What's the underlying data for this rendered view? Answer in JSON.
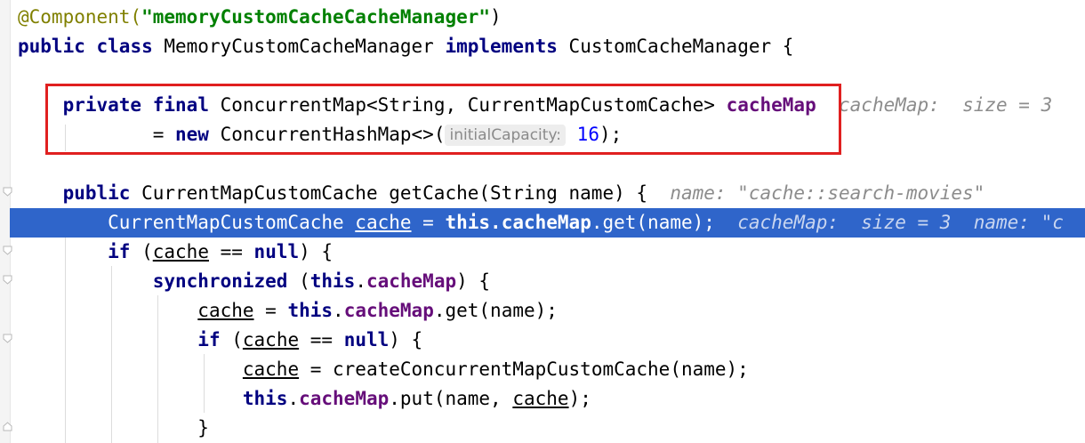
{
  "editor": {
    "lines": [
      {
        "id": "l1",
        "parts": [
          {
            "t": "@Component(",
            "c": "ann"
          },
          {
            "t": "\"memoryCustomCacheCacheManager\"",
            "c": "str"
          },
          {
            "t": ")",
            "c": ""
          }
        ]
      },
      {
        "id": "l2",
        "parts": [
          {
            "t": "public",
            "c": "kw"
          },
          {
            "t": " ",
            "c": ""
          },
          {
            "t": "class",
            "c": "kw"
          },
          {
            "t": " MemoryCustomCacheManager ",
            "c": ""
          },
          {
            "t": "implements",
            "c": "kw"
          },
          {
            "t": " CustomCacheManager {",
            "c": ""
          }
        ]
      },
      {
        "id": "l3",
        "parts": []
      },
      {
        "id": "l4",
        "parts": [
          {
            "t": "    ",
            "c": ""
          },
          {
            "t": "private",
            "c": "kw"
          },
          {
            "t": " ",
            "c": ""
          },
          {
            "t": "final",
            "c": "kw"
          },
          {
            "t": " ConcurrentMap<String, CurrentMapCustomCache> ",
            "c": ""
          },
          {
            "t": "cacheMap",
            "c": "fld"
          },
          {
            "t": "  ",
            "c": ""
          },
          {
            "t": "cacheMap:  size = 3",
            "c": "inlay"
          }
        ]
      },
      {
        "id": "l5",
        "parts": [
          {
            "t": "            = ",
            "c": ""
          },
          {
            "t": "new",
            "c": "kw"
          },
          {
            "t": " ConcurrentHashMap<>(",
            "c": ""
          },
          {
            "t": "initialCapacity:",
            "c": "param-hint"
          },
          {
            "t": " ",
            "c": ""
          },
          {
            "t": "16",
            "c": "num"
          },
          {
            "t": ");",
            "c": ""
          }
        ]
      },
      {
        "id": "l6",
        "parts": []
      },
      {
        "id": "l7",
        "parts": [
          {
            "t": "    ",
            "c": ""
          },
          {
            "t": "public",
            "c": "kw"
          },
          {
            "t": " CurrentMapCustomCache getCache(String name) {  ",
            "c": ""
          },
          {
            "t": "name: \"cache::search-movies\"",
            "c": "inlay"
          }
        ]
      },
      {
        "id": "l8",
        "hl": true,
        "parts": [
          {
            "t": "        CurrentMapCustomCache ",
            "c": ""
          },
          {
            "t": "cache",
            "c": "ul"
          },
          {
            "t": " = ",
            "c": ""
          },
          {
            "t": "this",
            "c": "kw"
          },
          {
            "t": ".",
            "c": "kw"
          },
          {
            "t": "cacheMap",
            "c": "fld"
          },
          {
            "t": ".get(name);  ",
            "c": ""
          },
          {
            "t": "cacheMap:  size = 3  name: \"c",
            "c": "inlay"
          }
        ]
      },
      {
        "id": "l9",
        "parts": [
          {
            "t": "        ",
            "c": ""
          },
          {
            "t": "if",
            "c": "kw"
          },
          {
            "t": " (",
            "c": ""
          },
          {
            "t": "cache",
            "c": "ul"
          },
          {
            "t": " == ",
            "c": ""
          },
          {
            "t": "null",
            "c": "kw"
          },
          {
            "t": ") {",
            "c": ""
          }
        ]
      },
      {
        "id": "l10",
        "parts": [
          {
            "t": "            ",
            "c": ""
          },
          {
            "t": "synchronized",
            "c": "kw"
          },
          {
            "t": " (",
            "c": ""
          },
          {
            "t": "this",
            "c": "kw"
          },
          {
            "t": ".",
            "c": ""
          },
          {
            "t": "cacheMap",
            "c": "fld"
          },
          {
            "t": ") {",
            "c": ""
          }
        ]
      },
      {
        "id": "l11",
        "parts": [
          {
            "t": "                ",
            "c": ""
          },
          {
            "t": "cache",
            "c": "ul"
          },
          {
            "t": " = ",
            "c": ""
          },
          {
            "t": "this",
            "c": "kw"
          },
          {
            "t": ".",
            "c": ""
          },
          {
            "t": "cacheMap",
            "c": "fld"
          },
          {
            "t": ".get(name);",
            "c": ""
          }
        ]
      },
      {
        "id": "l12",
        "parts": [
          {
            "t": "                ",
            "c": ""
          },
          {
            "t": "if",
            "c": "kw"
          },
          {
            "t": " (",
            "c": ""
          },
          {
            "t": "cache",
            "c": "ul"
          },
          {
            "t": " == ",
            "c": ""
          },
          {
            "t": "null",
            "c": "kw"
          },
          {
            "t": ") {",
            "c": ""
          }
        ]
      },
      {
        "id": "l13",
        "parts": [
          {
            "t": "                    ",
            "c": ""
          },
          {
            "t": "cache",
            "c": "ul"
          },
          {
            "t": " = createConcurrentMapCustomCache(name);",
            "c": ""
          }
        ]
      },
      {
        "id": "l14",
        "parts": [
          {
            "t": "                    ",
            "c": ""
          },
          {
            "t": "this",
            "c": "kw"
          },
          {
            "t": ".",
            "c": ""
          },
          {
            "t": "cacheMap",
            "c": "fld"
          },
          {
            "t": ".put(name, ",
            "c": ""
          },
          {
            "t": "cache",
            "c": "ul"
          },
          {
            "t": ");",
            "c": ""
          }
        ]
      },
      {
        "id": "l15",
        "parts": [
          {
            "t": "                }",
            "c": ""
          }
        ]
      }
    ]
  },
  "colors": {
    "highlight": "#2f65ca",
    "annotation_box": "#e02020"
  }
}
